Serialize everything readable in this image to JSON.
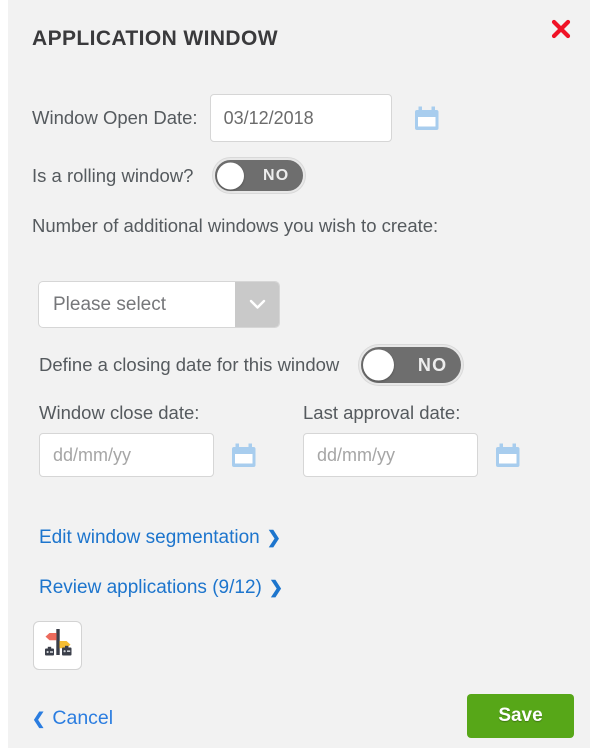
{
  "dialog": {
    "title": "APPLICATION WINDOW",
    "close_icon": "close-x-icon"
  },
  "open_date": {
    "label": "Window Open Date:",
    "value": "03/12/2018",
    "calendar_icon": "calendar-icon"
  },
  "rolling_window": {
    "label": "Is a rolling window?",
    "toggle_state": "NO"
  },
  "additional_windows": {
    "label": "Number of additional windows you wish to create:",
    "selected": "Please select",
    "arrow_icon": "chevron-down-icon"
  },
  "closing_date": {
    "label": "Define a closing date for this window",
    "toggle_state": "NO"
  },
  "window_close_date": {
    "label": "Window close date:",
    "value": "",
    "placeholder": "dd/mm/yy",
    "calendar_icon": "calendar-icon"
  },
  "last_approval_date": {
    "label": "Last approval date:",
    "value": "",
    "placeholder": "dd/mm/yy",
    "calendar_icon": "calendar-icon"
  },
  "links": {
    "segmentation": "Edit window segmentation",
    "segmentation_chevron": "❯",
    "review": "Review applications (9/12)",
    "review_chevron": "❯"
  },
  "attachment": {
    "icon": "signpost-luggage-icon"
  },
  "footer": {
    "cancel_label": "Cancel",
    "cancel_chevron": "❮",
    "save_label": "Save"
  },
  "colors": {
    "panel_bg": "#f2f2f2",
    "link_blue": "#1d75cd",
    "save_green": "#57a718",
    "close_red": "#f01226",
    "toggle_gray": "#6e6e6e",
    "calendar_blue": "#a8cdee"
  }
}
